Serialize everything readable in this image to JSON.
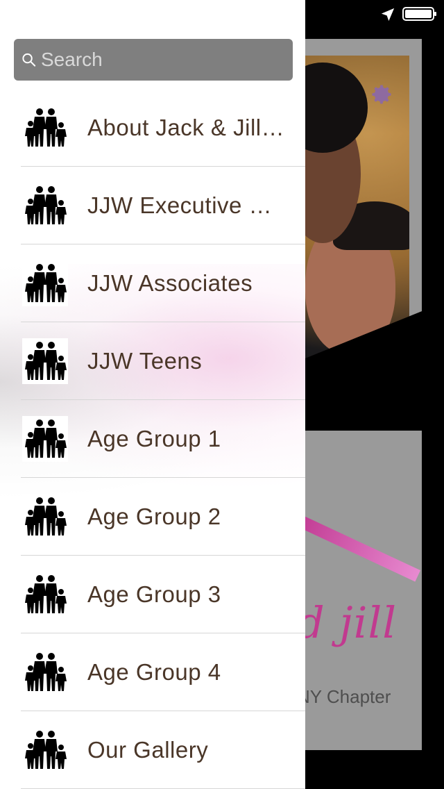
{
  "search": {
    "placeholder": "Search"
  },
  "menu": {
    "items": [
      {
        "label": "About Jack & Jill of America",
        "icon": "family-icon"
      },
      {
        "label": "JJW Executive Board",
        "icon": "family-icon"
      },
      {
        "label": "JJW Associates",
        "icon": "family-icon"
      },
      {
        "label": "JJW Teens",
        "icon": "family-icon"
      },
      {
        "label": "Age Group 1",
        "icon": "family-icon"
      },
      {
        "label": "Age Group 2",
        "icon": "family-icon"
      },
      {
        "label": "Age Group 3",
        "icon": "family-icon"
      },
      {
        "label": "Age Group 4",
        "icon": "family-icon"
      },
      {
        "label": "Our Gallery",
        "icon": "family-icon"
      }
    ]
  },
  "background": {
    "logo_text": "d jill",
    "chapter_text": "NY Chapter"
  },
  "colors": {
    "accent": "#c13a8f",
    "search_bg": "#7f7f7f",
    "menu_text": "#4a3628"
  }
}
